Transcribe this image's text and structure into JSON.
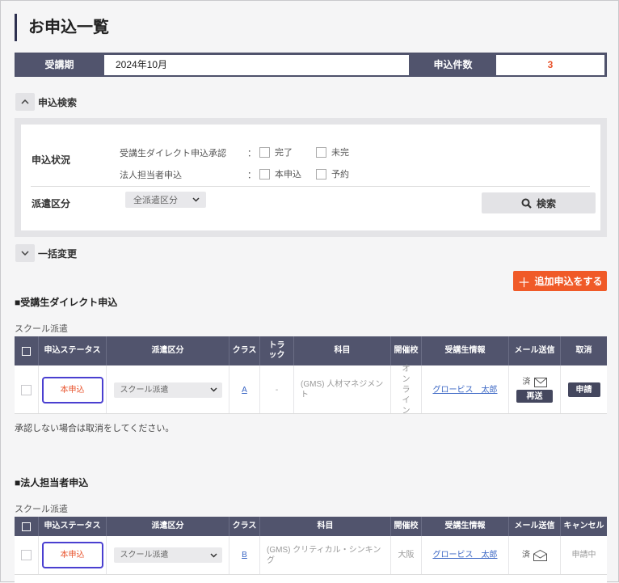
{
  "page_title": "お申込一覧",
  "summary": {
    "term_label": "受講期",
    "term_value": "2024年10月",
    "count_label": "申込件数",
    "count_value": "3"
  },
  "search": {
    "toggle_label": "申込検索",
    "status_label": "申込状況",
    "direct_approval_label": "受講生ダイレクト申込承認",
    "direct_colon": "：",
    "opt_done": "完了",
    "opt_pending": "未完",
    "corp_label": "法人担当者申込",
    "corp_colon": "：",
    "opt_main": "本申込",
    "opt_reserve": "予約",
    "dispatch_label": "派遣区分",
    "dispatch_select": "全派遣区分",
    "search_button": "検索"
  },
  "bulk": {
    "toggle_label": "一括変更"
  },
  "add_button": "追加申込をする",
  "direct_section": {
    "title": "■受講生ダイレクト申込",
    "subtitle": "スクール派遣",
    "headers": [
      "申込ステータス",
      "派遣区分",
      "クラス",
      "トラック",
      "科目",
      "開催校",
      "受講生情報",
      "メール送信",
      "取消"
    ],
    "row": {
      "status": "本申込",
      "dispatch": "スクール派遣",
      "class": "A",
      "track": "-",
      "subject": "(GMS) 人材マネジメント",
      "campus": "オンライン",
      "student": "グロービス　太郎",
      "mail_sent": "済",
      "resend": "再送",
      "action": "申請"
    },
    "note": "承認しない場合は取消をしてください。"
  },
  "corp_section": {
    "title": "■法人担当者申込",
    "subtitle": "スクール派遣",
    "headers": [
      "申込ステータス",
      "派遣区分",
      "クラス",
      "科目",
      "開催校",
      "受講生情報",
      "メール送信",
      "キャンセル"
    ],
    "row": {
      "status": "本申込",
      "dispatch": "スクール派遣",
      "class": "B",
      "subject": "(GMS) クリティカル・シンキング",
      "campus": "大阪",
      "student": "グロービス　太郎",
      "mail_sent": "済",
      "cancel": "申請中"
    }
  }
}
